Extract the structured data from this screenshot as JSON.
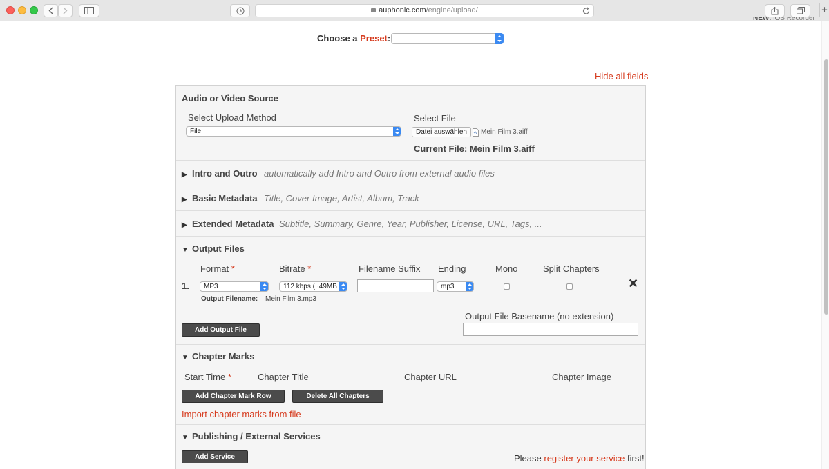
{
  "browser": {
    "url_domain": "auphonic.com",
    "url_path": "/engine/upload/",
    "new_tab": "+"
  },
  "top_banner": {
    "new_label": "NEW:",
    "text": "iOS Recorder"
  },
  "preset": {
    "label_prefix": "Choose a",
    "label_link": "Preset",
    "label_suffix": ":",
    "value": ""
  },
  "hide_all": "Hide all fields",
  "source": {
    "title": "Audio or Video Source",
    "upload_method_label": "Select Upload Method",
    "upload_method_value": "File",
    "select_file_label": "Select File",
    "file_button": "Datei auswählen",
    "file_name": "Mein Film 3.aiff",
    "current_file": "Current File: Mein Film 3.aiff"
  },
  "sections": {
    "intro": {
      "title": "Intro and Outro",
      "desc": "automatically add Intro and Outro from external audio files"
    },
    "basic": {
      "title": "Basic Metadata",
      "desc": "Title, Cover Image, Artist, Album, Track"
    },
    "extended": {
      "title": "Extended Metadata",
      "desc": "Subtitle, Summary, Genre, Year, Publisher, License, URL, Tags, ..."
    }
  },
  "output": {
    "title": "Output Files",
    "col_format": "Format",
    "col_bitrate": "Bitrate",
    "col_suffix": "Filename Suffix",
    "col_ending": "Ending",
    "col_mono": "Mono",
    "col_split": "Split Chapters",
    "required_mark": "*",
    "row_number": "1.",
    "format_value": "MP3",
    "bitrate_value": "112 kbps (~49MB",
    "suffix_value": "",
    "ending_value": "mp3",
    "remove": "✕",
    "output_filename_label": "Output Filename:",
    "output_filename_value": "Mein Film 3.mp3",
    "add_button": "Add Output File",
    "basename_label": "Output File Basename (no extension)",
    "basename_value": ""
  },
  "chapters": {
    "title": "Chapter Marks",
    "col_start": "Start Time",
    "col_title": "Chapter Title",
    "col_url": "Chapter URL",
    "col_image": "Chapter Image",
    "add_button": "Add Chapter Mark Row",
    "delete_button": "Delete All Chapters",
    "import_link": "Import chapter marks from file"
  },
  "publishing": {
    "title": "Publishing / External Services",
    "add_button": "Add Service",
    "note_prefix": "Please",
    "note_link": "register your service",
    "note_suffix": "first!"
  },
  "colors": {
    "accent": "#d63a1d",
    "button_dark": "#4b4b4b",
    "panel_bg": "#f5f5f5"
  }
}
